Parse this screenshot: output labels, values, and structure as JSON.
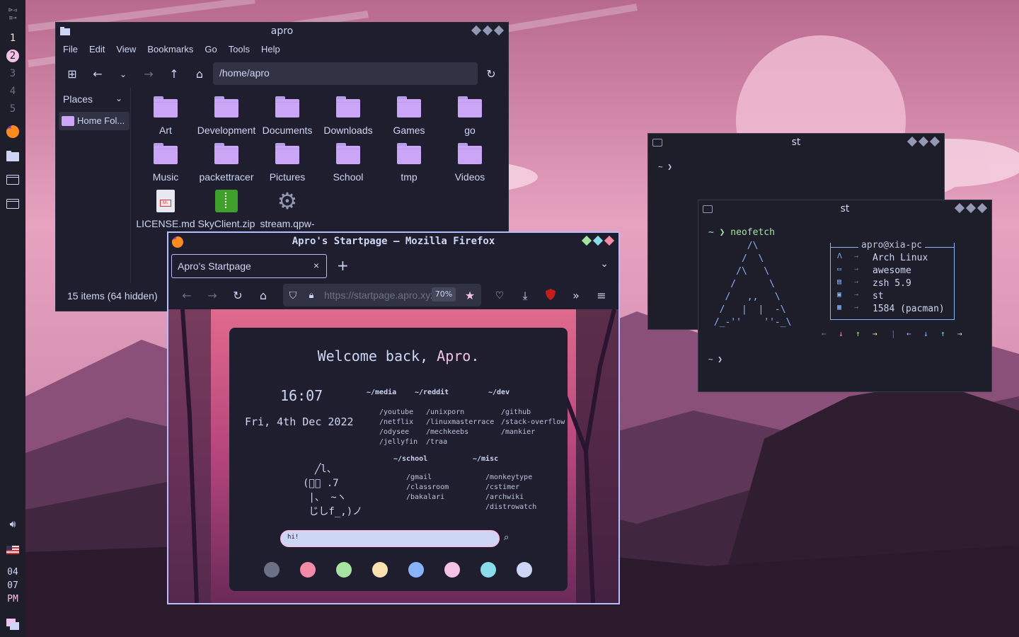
{
  "colors": {
    "accent": "#b4befe",
    "folder": "#cba6f7",
    "panel": "#1e1e2e",
    "pink": "#f5c2e7"
  },
  "bar": {
    "top_icons": [
      "window-layout-icon",
      "tag-icon"
    ],
    "workspaces": [
      "1",
      "2",
      "3",
      "4",
      "5"
    ],
    "apps": [
      "firefox-icon",
      "folder-icon",
      "terminal-icon",
      "terminal-icon"
    ],
    "tray": [
      "volume-icon",
      "us-flag-icon"
    ],
    "clock": {
      "hour": "04",
      "minute": "07",
      "ampm": "PM"
    },
    "bottom": "layout-icon"
  },
  "file_manager": {
    "title": "apro",
    "menu": [
      "File",
      "Edit",
      "View",
      "Bookmarks",
      "Go",
      "Tools",
      "Help"
    ],
    "path": "/home/apro",
    "places_label": "Places",
    "home_item": "Home Fol...",
    "status": "15 items (64 hidden)",
    "items": [
      {
        "name": "Art",
        "type": "folder"
      },
      {
        "name": "Development",
        "type": "folder"
      },
      {
        "name": "Documents",
        "type": "folder"
      },
      {
        "name": "Downloads",
        "type": "folder"
      },
      {
        "name": "Games",
        "type": "folder"
      },
      {
        "name": "go",
        "type": "folder"
      },
      {
        "name": "Music",
        "type": "folder"
      },
      {
        "name": "packettracer",
        "type": "folder"
      },
      {
        "name": "Pictures",
        "type": "folder"
      },
      {
        "name": "School",
        "type": "folder"
      },
      {
        "name": "tmp",
        "type": "folder"
      },
      {
        "name": "Videos",
        "type": "folder"
      },
      {
        "name": "LICENSE.md",
        "type": "markdown"
      },
      {
        "name": "SkyClient.zip",
        "type": "zip"
      },
      {
        "name": "stream.qpw-",
        "type": "settings"
      }
    ]
  },
  "st1": {
    "title": "st",
    "prompt": "~ ❯"
  },
  "st2": {
    "title": "st",
    "command": "~ ❯ neofetch",
    "art": "       /\\\n      /  \\\n     /\\   \\\n    /      \\\n   /   ,,   \\\n  /   |  |  -\\\n /_-''    ''-_\\",
    "user": "apro@xia-pc",
    "info": [
      {
        "icon": "ᐱ",
        "arrow": "→",
        "value": "Arch Linux"
      },
      {
        "icon": "▭",
        "arrow": "→",
        "value": "awesome"
      },
      {
        "icon": "▤",
        "arrow": "→",
        "value": "zsh 5.9"
      },
      {
        "icon": "▣",
        "arrow": "→",
        "value": "st"
      },
      {
        "icon": "▦",
        "arrow": "→",
        "value": "1584 (pacman)"
      }
    ],
    "arrows_left": [
      "←",
      "↓",
      "↑",
      "→"
    ],
    "separator": "|",
    "arrows_right": [
      "←",
      "↓",
      "↑",
      "→"
    ],
    "prompt2": "~ ❯"
  },
  "firefox": {
    "title": "Apro's Startpage — Mozilla Firefox",
    "tab": "Apro's Startpage",
    "url": "https://startpage.apro.xyz",
    "zoom": "70%",
    "startpage": {
      "greeting": "Welcome back, ",
      "name": "Apro.",
      "time": "16:07",
      "date": "Fri, 4th Dec 2022",
      "groups": [
        {
          "title": "~/media",
          "links": [
            "/youtube",
            "/netflix",
            "/odysee",
            "/jellyfin"
          ]
        },
        {
          "title": "~/reddit",
          "links": [
            "/unixporn",
            "/linuxmasterrace",
            "/mechkeebs",
            "/traa"
          ]
        },
        {
          "title": "~/dev",
          "links": [
            "/github",
            "/stack-overflow",
            "/mankier"
          ]
        },
        {
          "title": "~/school",
          "links": [
            "/gmail",
            "/classroom",
            "/bakalari"
          ]
        },
        {
          "title": "~/misc",
          "links": [
            "/monkeytype",
            "/cstimer",
            "/archwiki",
            "/distrowatch"
          ]
        }
      ],
      "ascii": "  ╱l、\n(ﾟ、 .7\n |、 ~ヽ\n じしf_,)ノ",
      "search_value": "hi!",
      "swatches": [
        "#6c7086",
        "#f38ba8",
        "#a6e3a1",
        "#f9e2af",
        "#89b4fa",
        "#f5c2e7",
        "#89dceb",
        "#cdd6f4"
      ]
    }
  }
}
